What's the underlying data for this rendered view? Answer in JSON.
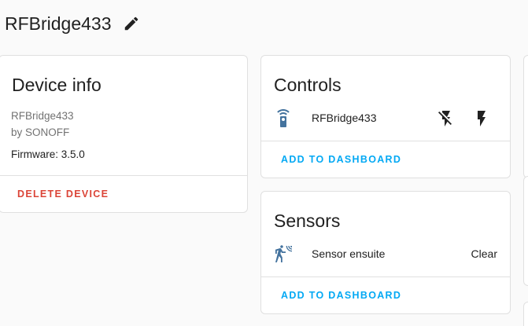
{
  "page": {
    "title": "RFBridge433"
  },
  "colors": {
    "primary": "#03a9f4",
    "error": "#db4437",
    "state_icon": "#44739e"
  },
  "device_info": {
    "title": "Device info",
    "model": "RFBridge433",
    "manufacturer": "by SONOFF",
    "firmware": "Firmware: 3.5.0",
    "delete_label": "DELETE DEVICE"
  },
  "controls": {
    "title": "Controls",
    "entity": {
      "name": "RFBridge433",
      "icon": "remote-icon",
      "buttons": [
        "flash-off-icon",
        "flash-icon"
      ]
    },
    "action_label": "ADD TO DASHBOARD"
  },
  "sensors": {
    "title": "Sensors",
    "entity": {
      "name": "Sensor ensuite",
      "icon": "motion-sensor-icon",
      "state": "Clear"
    },
    "action_label": "ADD TO DASHBOARD"
  }
}
